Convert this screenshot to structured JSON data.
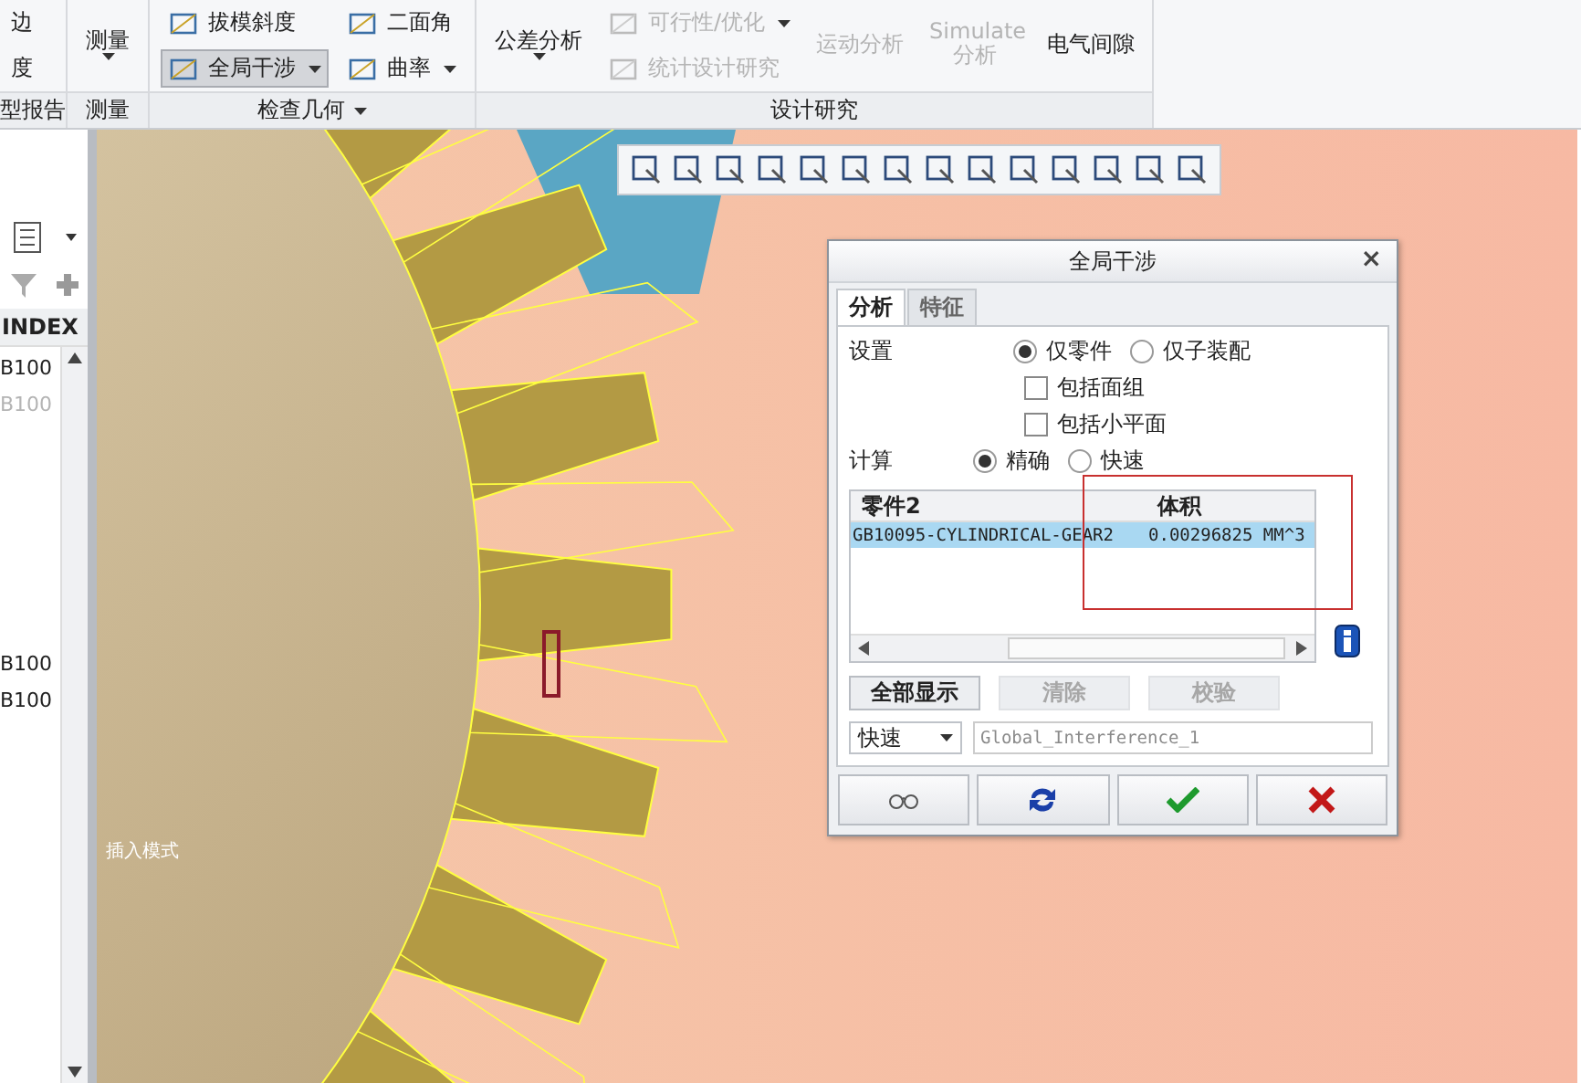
{
  "ribbon": {
    "groups": [
      {
        "label": "型报告",
        "caret": false,
        "columns": [
          [
            {
              "kind": "plain",
              "label": "边",
              "disabled": false,
              "selected": false
            },
            {
              "kind": "plain",
              "label": "度",
              "disabled": false,
              "selected": false
            }
          ]
        ]
      },
      {
        "label": "测量",
        "caret": false,
        "columns": [
          [
            {
              "kind": "large",
              "label": "测量",
              "disabled": false,
              "selected": false,
              "caret": true
            }
          ]
        ]
      },
      {
        "label": "检查几何",
        "caret": true,
        "columns": [
          [
            {
              "kind": "small",
              "label": "拔模斜度",
              "disabled": false,
              "selected": false,
              "caret": false
            },
            {
              "kind": "small",
              "label": "全局干涉",
              "disabled": false,
              "selected": true,
              "caret": true
            }
          ],
          [
            {
              "kind": "small",
              "label": "二面角",
              "disabled": false,
              "selected": false,
              "caret": false
            },
            {
              "kind": "small",
              "label": "曲率",
              "disabled": false,
              "selected": false,
              "caret": true
            }
          ]
        ]
      },
      {
        "label": "设计研究",
        "caret": false,
        "columns": [
          [
            {
              "kind": "large",
              "label": "公差分析",
              "disabled": false,
              "selected": false,
              "caret": true
            }
          ],
          [
            {
              "kind": "small",
              "label": "可行性/优化",
              "disabled": true,
              "selected": false,
              "caret": true
            },
            {
              "kind": "small",
              "label": "统计设计研究",
              "disabled": true,
              "selected": false,
              "caret": false
            }
          ],
          [
            {
              "kind": "large",
              "label": "运动分析",
              "disabled": true,
              "selected": false,
              "caret": false
            }
          ],
          [
            {
              "kind": "large",
              "label": "Simulate 分析",
              "disabled": true,
              "selected": false,
              "caret": false
            }
          ],
          [
            {
              "kind": "large",
              "label": "电气间隙",
              "disabled": false,
              "selected": false,
              "caret": false
            }
          ]
        ]
      }
    ]
  },
  "tree": {
    "header": "INDEX",
    "groups": [
      [
        {
          "label": "B100",
          "disabled": false
        },
        {
          "label": "B100",
          "disabled": true
        }
      ],
      [
        {
          "label": "B100",
          "disabled": false
        },
        {
          "label": "B100",
          "disabled": false
        }
      ]
    ]
  },
  "viewport": {
    "mode_label": "插入模式"
  },
  "dialog": {
    "title": "全局干涉",
    "close": "×",
    "tabs": [
      {
        "label": "分析",
        "selected": true
      },
      {
        "label": "特征",
        "selected": false
      }
    ],
    "settings_label": "设置",
    "scope": [
      {
        "label": "仅零件",
        "selected": true
      },
      {
        "label": "仅子装配",
        "selected": false
      }
    ],
    "options": [
      {
        "label": "包括面组",
        "checked": false
      },
      {
        "label": "包括小平面",
        "checked": false
      }
    ],
    "calc_label": "计算",
    "calc": [
      {
        "label": "精确",
        "selected": true
      },
      {
        "label": "快速",
        "selected": false
      }
    ],
    "table": {
      "columns": [
        "零件2",
        "体积"
      ],
      "rows": [
        {
          "cells": [
            "GB10095-CYLINDRICAL-GEAR2",
            "0.00296825 MM^3"
          ],
          "selected": true
        }
      ]
    },
    "actions": [
      {
        "label": "全部显示",
        "disabled": false
      },
      {
        "label": "清除",
        "disabled": true
      },
      {
        "label": "校验",
        "disabled": true
      }
    ],
    "mode": {
      "value": "快速"
    },
    "name_field": {
      "value": "Global_Interference_1"
    }
  }
}
